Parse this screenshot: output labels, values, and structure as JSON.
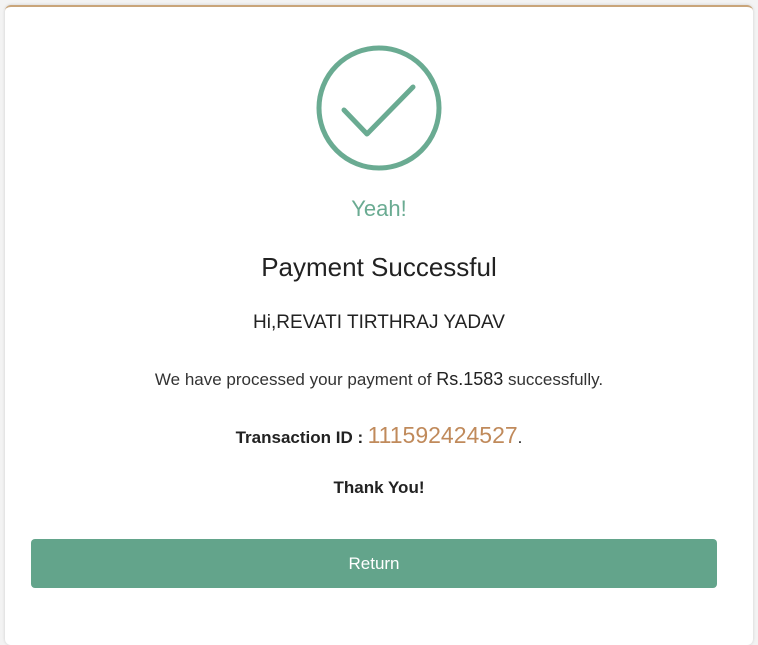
{
  "status": {
    "icon": "check-circle-icon",
    "exclamation": "Yeah!",
    "title": "Payment Successful"
  },
  "message": {
    "greeting": "Hi,REVATI TIRTHRAJ YADAV",
    "processed_prefix": "We have processed your payment of ",
    "amount": "Rs.1583",
    "processed_suffix": " successfully."
  },
  "transaction": {
    "label": "Transaction ID :",
    "id": "111592424527",
    "trailing": "."
  },
  "thanks": "Thank You!",
  "actions": {
    "return_label": "Return"
  },
  "colors": {
    "accent": "#63a48b",
    "check": "#6aab92",
    "transaction_id": "#c08a5b",
    "border_top": "#c9a57a"
  }
}
